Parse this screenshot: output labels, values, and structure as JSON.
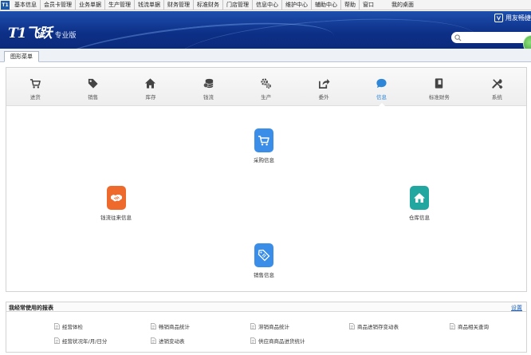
{
  "menubar": {
    "logo": "T1",
    "items": [
      "基本信息",
      "会员卡管理",
      "业务单据",
      "生产管理",
      "钱流单据",
      "财务管理",
      "标准财务",
      "门店管理",
      "信息中心",
      "维护中心",
      "辅助中心",
      "帮助",
      "窗口",
      "我的桌面"
    ]
  },
  "header": {
    "brand_logo": "T1飞跃",
    "brand_edition": "专业版",
    "vendor": "用友畅捷",
    "search_placeholder": ""
  },
  "tabs": [
    "图形菜单"
  ],
  "nav": {
    "active_index": 6,
    "items": [
      {
        "label": "进货",
        "icon": "cart-icon"
      },
      {
        "label": "销售",
        "icon": "tag-icon"
      },
      {
        "label": "库存",
        "icon": "home-icon"
      },
      {
        "label": "钱流",
        "icon": "coins-icon"
      },
      {
        "label": "生产",
        "icon": "gears-icon"
      },
      {
        "label": "委外",
        "icon": "share-icon"
      },
      {
        "label": "信息",
        "icon": "chat-icon"
      },
      {
        "label": "标准财务",
        "icon": "book-icon"
      },
      {
        "label": "系统",
        "icon": "tools-icon"
      }
    ]
  },
  "tiles": {
    "purchase_info": {
      "label": "采购信息",
      "icon": "cart-icon",
      "color": "#3b8ee8"
    },
    "cash_flow_info": {
      "label": "钱流往来信息",
      "icon": "handshake-icon",
      "color": "#ee6a2c"
    },
    "warehouse_info": {
      "label": "仓库信息",
      "icon": "house-icon",
      "color": "#22a7a0"
    },
    "sales_info": {
      "label": "销售信息",
      "icon": "sale-tag-icon",
      "color": "#3b8ee8"
    }
  },
  "reports": {
    "title": "我经常使用的报表",
    "settings_label": "设置",
    "items": [
      "经营体检",
      "畅销商品统计",
      "滞销商品统计",
      "商品进销存变动表",
      "商品相关查询",
      "经营状况年/月/日分",
      "进销变动表",
      "供应商商品进货统计"
    ]
  },
  "colors": {
    "header_blue": "#0d2f86",
    "active_nav": "#2d86d8",
    "link_blue": "#1f5fb4"
  }
}
